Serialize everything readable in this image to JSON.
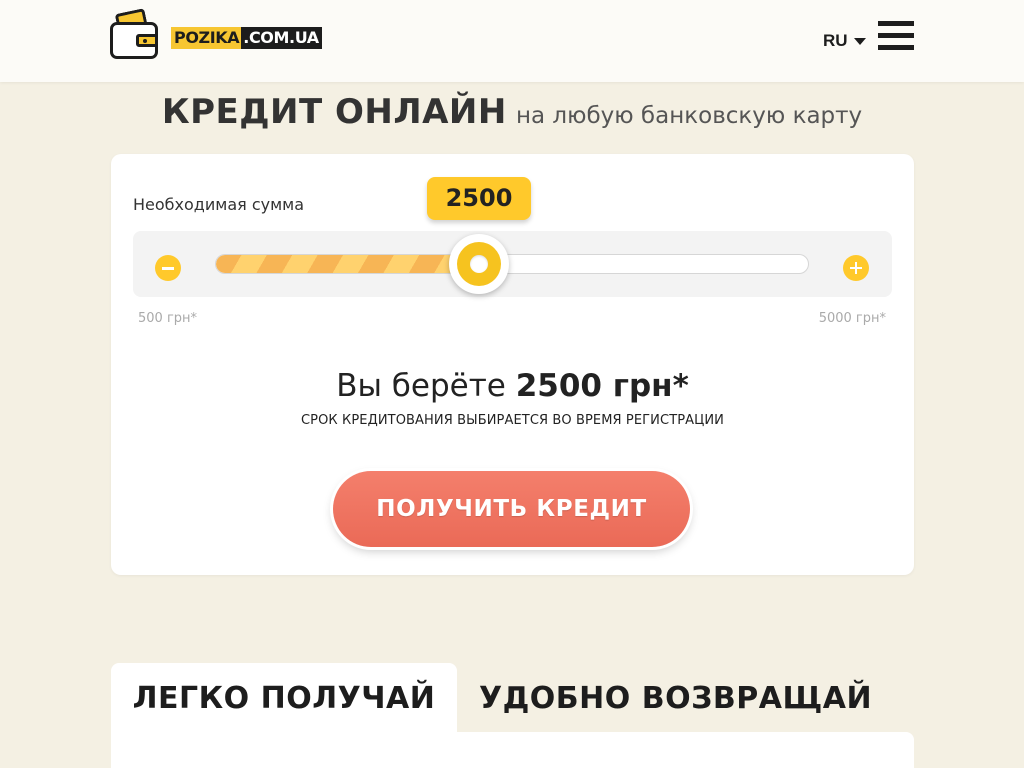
{
  "header": {
    "logo": {
      "part1": "POZIKA",
      "part2": ".COM.UA"
    },
    "language": "RU",
    "menu_icon": "hamburger-menu-icon"
  },
  "headline": {
    "main": "КРЕДИТ ОНЛАЙН",
    "sub": "на любую банковскую карту"
  },
  "calculator": {
    "label": "Необходимая сумма",
    "current_value": "2500",
    "min_label": "500 грн*",
    "max_label": "5000 грн*",
    "min": 500,
    "max": 5000,
    "value": 2500,
    "take_prefix": "Вы берёте",
    "take_amount": "2500 грн*",
    "term_note": "СРОК КРЕДИТОВАНИЯ ВЫБИРАЕТСЯ ВО ВРЕМЯ РЕГИСТРАЦИИ",
    "cta": "ПОЛУЧИТЬ КРЕДИТ",
    "minus_icon": "minus-icon",
    "plus_icon": "plus-icon"
  },
  "tabs": [
    {
      "label": "ЛЕГКО ПОЛУЧАЙ",
      "active": true
    },
    {
      "label": "УДОБНО ВОЗВРАЩАЙ",
      "active": false
    }
  ],
  "colors": {
    "accent_yellow": "#ffc92b",
    "cta_red": "#ef7562",
    "background": "#f4f0e3"
  }
}
